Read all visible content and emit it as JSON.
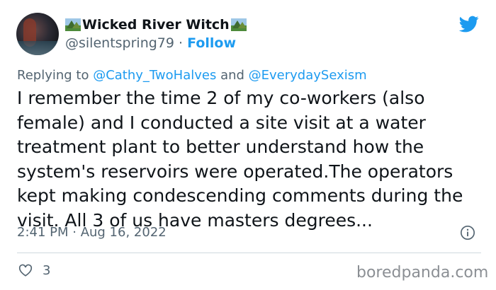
{
  "author": {
    "display_name": "Wicked River Witch",
    "handle": "@silentspring79",
    "separator": "·",
    "follow_label": "Follow"
  },
  "reply": {
    "prefix": "Replying to ",
    "mention_1": "@Cathy_TwoHalves",
    "conjunction": " and ",
    "mention_2": "@EverydaySexism"
  },
  "tweet": {
    "text": "I remember the time 2 of my co-workers (also female) and I conducted a site visit at a water treatment plant to better understand how the system's reservoirs were operated.The operators kept making condescending comments during the visit. All 3 of us have masters degrees...",
    "timestamp": "2:41 PM · Aug 16, 2022"
  },
  "engagement": {
    "likes": "3"
  },
  "watermark": "boredpanda.com",
  "icons": {
    "brand": "twitter-bird-icon",
    "info": "info-icon",
    "like": "heart-icon",
    "name_emoji": "national-park-emoji"
  },
  "colors": {
    "accent": "#1d9bf0",
    "text": "#0f1419",
    "secondary": "#536471",
    "divider": "#cfd9de"
  }
}
